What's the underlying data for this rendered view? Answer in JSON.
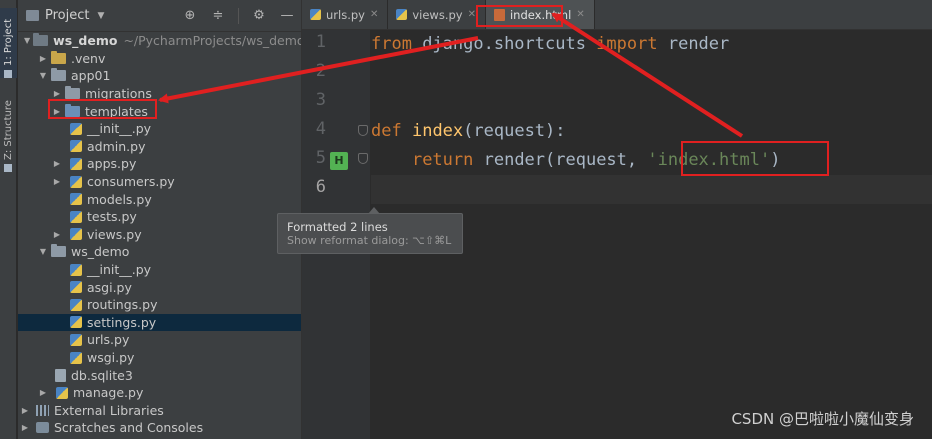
{
  "tool_strip": {
    "project_tab": "1: Project",
    "structure_tab": "Z: Structure"
  },
  "project_panel": {
    "title": "Project",
    "tree": [
      {
        "label": "ws_demo",
        "path_hint": "~/PycharmProjects/ws_demo",
        "bold": true,
        "expanded": true,
        "icon": "folder-icon"
      },
      {
        "label": ".venv",
        "expanded": false,
        "icon": "folder-icon"
      },
      {
        "label": "app01",
        "expanded": true,
        "icon": "folder-icon"
      },
      {
        "label": "migrations",
        "expanded": false,
        "icon": "folder-icon"
      },
      {
        "label": "templates",
        "expanded": false,
        "icon": "folder-icon",
        "highlighted": true
      },
      {
        "label": "__init__.py",
        "icon": "python-file-icon"
      },
      {
        "label": "admin.py",
        "icon": "python-file-icon"
      },
      {
        "label": "apps.py",
        "expanded": false,
        "icon": "python-file-icon"
      },
      {
        "label": "consumers.py",
        "expanded": false,
        "icon": "python-file-icon"
      },
      {
        "label": "models.py",
        "icon": "python-file-icon"
      },
      {
        "label": "tests.py",
        "icon": "python-file-icon"
      },
      {
        "label": "views.py",
        "expanded": false,
        "icon": "python-file-icon"
      },
      {
        "label": "ws_demo",
        "expanded": true,
        "icon": "folder-icon"
      },
      {
        "label": "__init__.py",
        "icon": "python-file-icon"
      },
      {
        "label": "asgi.py",
        "icon": "python-file-icon"
      },
      {
        "label": "routings.py",
        "icon": "python-file-icon"
      },
      {
        "label": "settings.py",
        "icon": "python-file-icon",
        "selected": true
      },
      {
        "label": "urls.py",
        "icon": "python-file-icon"
      },
      {
        "label": "wsgi.py",
        "icon": "python-file-icon"
      },
      {
        "label": "db.sqlite3",
        "icon": "database-file-icon"
      },
      {
        "label": "manage.py",
        "expanded": false,
        "icon": "python-file-icon"
      },
      {
        "label": "External Libraries",
        "expanded": false,
        "icon": "library-icon"
      },
      {
        "label": "Scratches and Consoles",
        "expanded": false,
        "icon": "scratches-icon"
      }
    ]
  },
  "editor": {
    "tabs": [
      {
        "label": "urls.py",
        "icon": "python-file-icon"
      },
      {
        "label": "views.py",
        "icon": "python-file-icon"
      },
      {
        "label": "index.html",
        "icon": "html-file-icon",
        "active": true
      }
    ],
    "line_numbers": [
      "1",
      "2",
      "3",
      "4",
      "5",
      "6"
    ],
    "code": {
      "l1_kw1": "from",
      "l1_mod": " django.shortcuts ",
      "l1_kw2": "import",
      "l1_name": " render",
      "l4_kw": "def",
      "l4_fn": "index",
      "l4_args": "(request):",
      "l5_kw": "return",
      "l5_call": " render(request, ",
      "l5_str": "'index.html'",
      "l5_end": ")"
    },
    "popup": {
      "title": "Formatted 2 lines",
      "hint": "Show reformat dialog: ⌥⇧⌘L"
    }
  },
  "watermark": "CSDN @巴啦啦小魔仙变身",
  "colors": {
    "annotation_red": "#e02020",
    "keyword": "#cc7832",
    "function": "#ffc66d",
    "string": "#6a8759",
    "selection": "#0d293e"
  }
}
